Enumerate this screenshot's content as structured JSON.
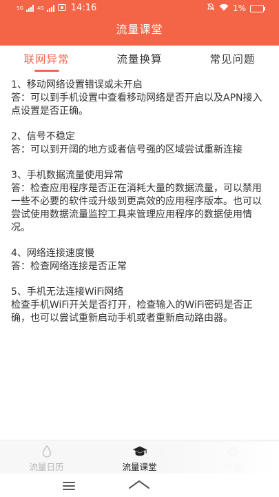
{
  "status_bar": {
    "signal_1": "5G",
    "signal_2": "4G",
    "time": "14:16",
    "battery": "1%"
  },
  "header": {
    "title": "流量课堂"
  },
  "tabs": [
    {
      "label": "联网异常",
      "active": true
    },
    {
      "label": "流量换算",
      "active": false
    },
    {
      "label": "常见问题",
      "active": false
    }
  ],
  "faq": [
    {
      "question": "1、移动网络设置错误或未开启",
      "answer": "答：可以到手机设置中查看移动网络是否开启以及APN接入点设置是否正确。"
    },
    {
      "question": "2、信号不稳定",
      "answer": "答：可以到开阔的地方或者信号强的区域尝试重新连接"
    },
    {
      "question": "3、手机数据流量使用异常",
      "answer": "答：检查应用程序是否正在消耗大量的数据流量，可以禁用一些不必要的软件或升级到更高效的应用程序版本。也可以尝试使用数据流量监控工具来管理应用程序的数据使用情况。"
    },
    {
      "question": "4、网络连接速度慢",
      "answer": "答：检查网络连接是否正常"
    },
    {
      "question": "5、手机无法连接WiFi网络",
      "answer": "检查手机WiFi开关是否打开，检查输入的WiFi密码是否正确，也可以尝试重新启动手机或者重新启动路由器。"
    }
  ],
  "bottom_nav": [
    {
      "label": "流量日历",
      "icon": "drop-icon",
      "active": false
    },
    {
      "label": "流量课堂",
      "icon": "graduation-cap-icon",
      "active": true
    },
    {
      "label": "流量",
      "icon": "leaf-icon",
      "active": false
    }
  ],
  "colors": {
    "accent": "#f46446",
    "text": "#333333",
    "inactive": "#b8b8b8"
  }
}
